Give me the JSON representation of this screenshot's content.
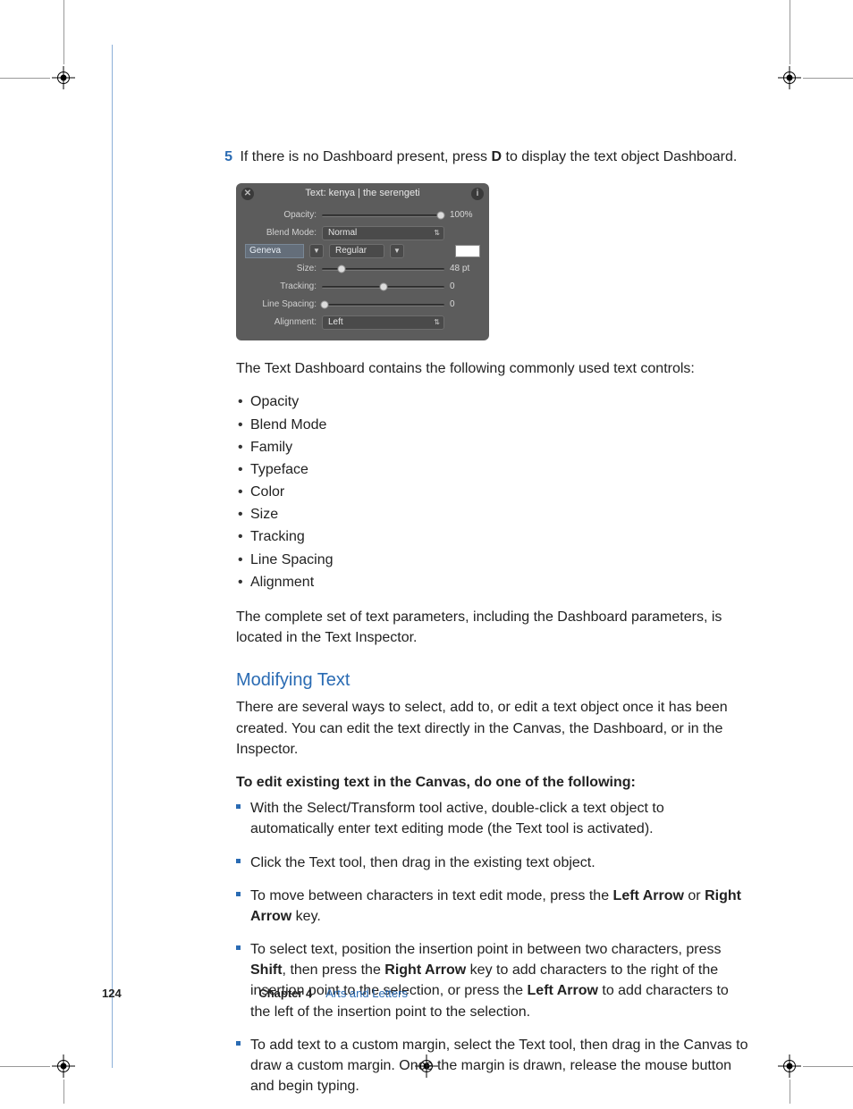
{
  "step": {
    "number": "5",
    "text_a": "If there is no Dashboard present, press ",
    "key": "D",
    "text_b": " to display the text object Dashboard."
  },
  "dashboard": {
    "title": "Text: kenya | the serengeti",
    "opacity": {
      "label": "Opacity:",
      "value": "100%",
      "pos": 100
    },
    "blend": {
      "label": "Blend Mode:",
      "value": "Normal"
    },
    "font": {
      "name": "Geneva",
      "style": "Regular"
    },
    "size": {
      "label": "Size:",
      "value": "48 pt",
      "pos": 16
    },
    "tracking": {
      "label": "Tracking:",
      "value": "0",
      "pos": 50
    },
    "spacing": {
      "label": "Line Spacing:",
      "value": "0",
      "pos": 2
    },
    "align": {
      "label": "Alignment:",
      "value": "Left"
    }
  },
  "intro": "The Text Dashboard contains the following commonly used text controls:",
  "controls": [
    "Opacity",
    "Blend Mode",
    "Family",
    "Typeface",
    "Color",
    "Size",
    "Tracking",
    "Line Spacing",
    "Alignment"
  ],
  "para_complete": "The complete set of text parameters, including the Dashboard parameters, is located in the Text Inspector.",
  "heading": "Modifying Text",
  "mod_intro": "There are several ways to select, add to, or edit a text object once it has been created. You can edit the text directly in the Canvas, the Dashboard, or in the Inspector.",
  "bold_line": "To edit existing text in the Canvas, do one of the following:",
  "items": {
    "i1": "With the Select/Transform tool active, double-click a text object to automatically enter text editing mode (the Text tool is activated).",
    "i2": "Click the Text tool, then drag in the existing text object.",
    "i3": {
      "a": "To move between characters in text edit mode, press the ",
      "b": "Left Arrow",
      "c": " or ",
      "d": "Right Arrow",
      "e": " key."
    },
    "i4": {
      "a": "To select text, position the insertion point in between two characters, press ",
      "b": "Shift",
      "c": ", then press the ",
      "d": "Right Arrow",
      "e": " key to add characters to the right of the insertion point to the selection, or press the ",
      "f": "Left Arrow",
      "g": " to add characters to the left of the insertion point to the selection."
    },
    "i5": "To add text to a custom margin, select the Text tool, then drag in the Canvas to draw a custom margin. Once the margin is drawn, release the mouse button and begin typing."
  },
  "footer": {
    "page": "124",
    "chapter": "Chapter 4",
    "name": "Arts and Letters"
  }
}
